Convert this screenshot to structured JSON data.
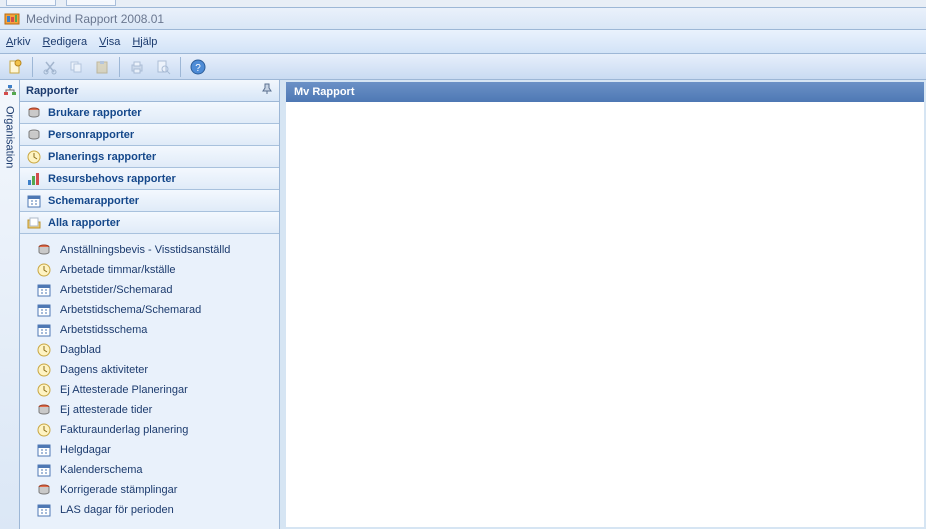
{
  "window": {
    "title": "Medvind Rapport 2008.01"
  },
  "menu": {
    "arkiv": "Arkiv",
    "redigera": "Redigera",
    "visa": "Visa",
    "hjalp": "Hjälp"
  },
  "orgtab": {
    "label": "Organisation"
  },
  "sidebar": {
    "title": "Rapporter",
    "categories": [
      {
        "label": "Brukare rapporter",
        "icon": "stack-red"
      },
      {
        "label": "Personrapporter",
        "icon": "stack-grey"
      },
      {
        "label": "Planerings rapporter",
        "icon": "clock"
      },
      {
        "label": "Resursbehovs rapporter",
        "icon": "chart"
      },
      {
        "label": "Schemarapporter",
        "icon": "calendar"
      },
      {
        "label": "Alla rapporter",
        "icon": "folder"
      }
    ],
    "reports": [
      {
        "label": "Anställningsbevis - Visstidsanställd",
        "icon": "stack-red"
      },
      {
        "label": "Arbetade timmar/kställe",
        "icon": "clock"
      },
      {
        "label": "Arbetstider/Schemarad",
        "icon": "calendar"
      },
      {
        "label": "Arbetstidschema/Schemarad",
        "icon": "calendar"
      },
      {
        "label": "Arbetstidsschema",
        "icon": "calendar"
      },
      {
        "label": "Dagblad",
        "icon": "clock"
      },
      {
        "label": "Dagens aktiviteter",
        "icon": "clock"
      },
      {
        "label": "Ej Attesterade Planeringar",
        "icon": "clock"
      },
      {
        "label": "Ej attesterade tider",
        "icon": "stack-red"
      },
      {
        "label": "Fakturaunderlag planering",
        "icon": "clock"
      },
      {
        "label": "Helgdagar",
        "icon": "calendar"
      },
      {
        "label": "Kalenderschema",
        "icon": "calendar"
      },
      {
        "label": "Korrigerade stämplingar",
        "icon": "stack-red"
      },
      {
        "label": "LAS dagar för perioden",
        "icon": "calendar"
      }
    ]
  },
  "content": {
    "title": "Mv Rapport"
  }
}
